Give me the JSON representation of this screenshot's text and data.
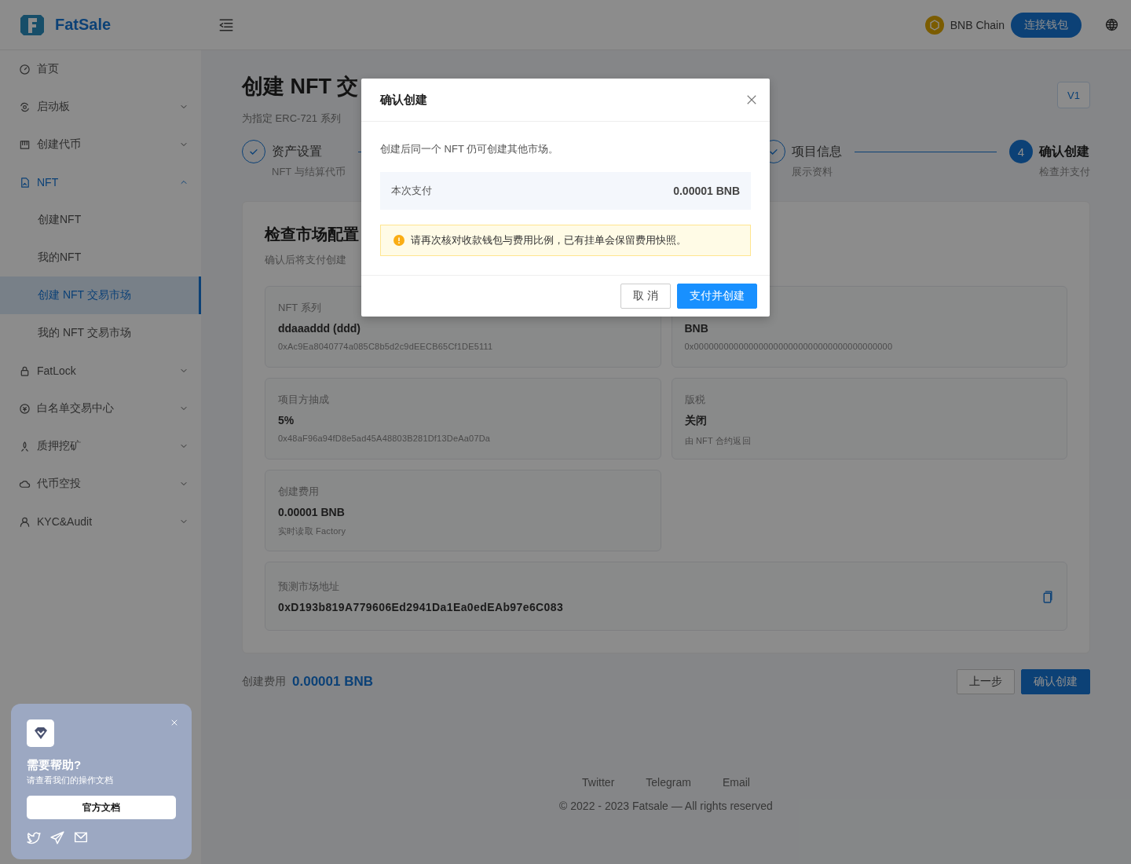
{
  "header": {
    "brand": "FatSale",
    "network": "BNB Chain",
    "connect_button": "连接钱包"
  },
  "sidebar": {
    "items": [
      {
        "label": "首页"
      },
      {
        "label": "启动板",
        "expanded": false
      },
      {
        "label": "创建代币",
        "expanded": false
      },
      {
        "label": "NFT",
        "expanded": true,
        "children": [
          {
            "label": "创建NFT",
            "selected": false
          },
          {
            "label": "我的NFT",
            "selected": false
          },
          {
            "label": "创建 NFT 交易市场",
            "selected": true
          },
          {
            "label": "我的 NFT 交易市场",
            "selected": false
          }
        ]
      },
      {
        "label": "FatLock",
        "expanded": false
      },
      {
        "label": "白名单交易中心",
        "expanded": false
      },
      {
        "label": "质押挖矿",
        "expanded": false
      },
      {
        "label": "代币空投",
        "expanded": false
      },
      {
        "label": "KYC&Audit",
        "expanded": false
      }
    ]
  },
  "help_card": {
    "title": "需要帮助?",
    "subtitle": "请查看我们的操作文档",
    "button": "官方文档"
  },
  "page": {
    "title": "创建 NFT 交",
    "subtitle": "为指定 ERC-721 系列",
    "version": "V1",
    "steps": [
      {
        "kind": "check",
        "title": "资产设置",
        "description": "NFT 与结算代币"
      },
      {
        "kind": "check",
        "title": "项目信息",
        "description": "展示资料"
      },
      {
        "kind": "number",
        "number": "4",
        "title": "确认创建",
        "description": "检查并支付"
      }
    ],
    "review": {
      "title": "检查市场配置",
      "subtitle": "确认后将支付创建",
      "fields": [
        {
          "label": "NFT 系列",
          "value": "ddaaaddd (ddd)",
          "note": "0xAc9Ea8040774a085C8b5d2c9dEECB65Cf1DE5111"
        },
        {
          "value": "BNB",
          "note": "0x0000000000000000000000000000000000000000"
        },
        {
          "label": "项目方抽成",
          "value": "5%",
          "note": "0x48aF96a94fD8e5ad45A48803B281Df13DeAa07Da"
        },
        {
          "label": "版税",
          "value": "关闭",
          "note": "由 NFT 合约返回"
        },
        {
          "label": "创建费用",
          "value": "0.00001 BNB",
          "note": "实时读取 Factory"
        }
      ],
      "address": {
        "label": "预测市场地址",
        "value": "0xD193b819A779606Ed2941Da1Ea0edEAb97e6C083"
      }
    },
    "fee": {
      "label": "创建费用",
      "value": "0.00001 BNB"
    },
    "buttons": {
      "back": "上一步",
      "confirm": "确认创建"
    }
  },
  "footer": {
    "links": [
      "Twitter",
      "Telegram",
      "Email"
    ],
    "copyright": "© 2022 - 2023 Fatsale — All rights reserved"
  },
  "modal": {
    "title": "确认创建",
    "message": "创建后同一个 NFT 仍可创建其他市场。",
    "payment_label": "本次支付",
    "payment_value": "0.00001 BNB",
    "warning": "请再次核对收款钱包与费用比例，已有挂单会保留费用快照。",
    "cancel": "取 消",
    "ok": "支付并创建"
  }
}
